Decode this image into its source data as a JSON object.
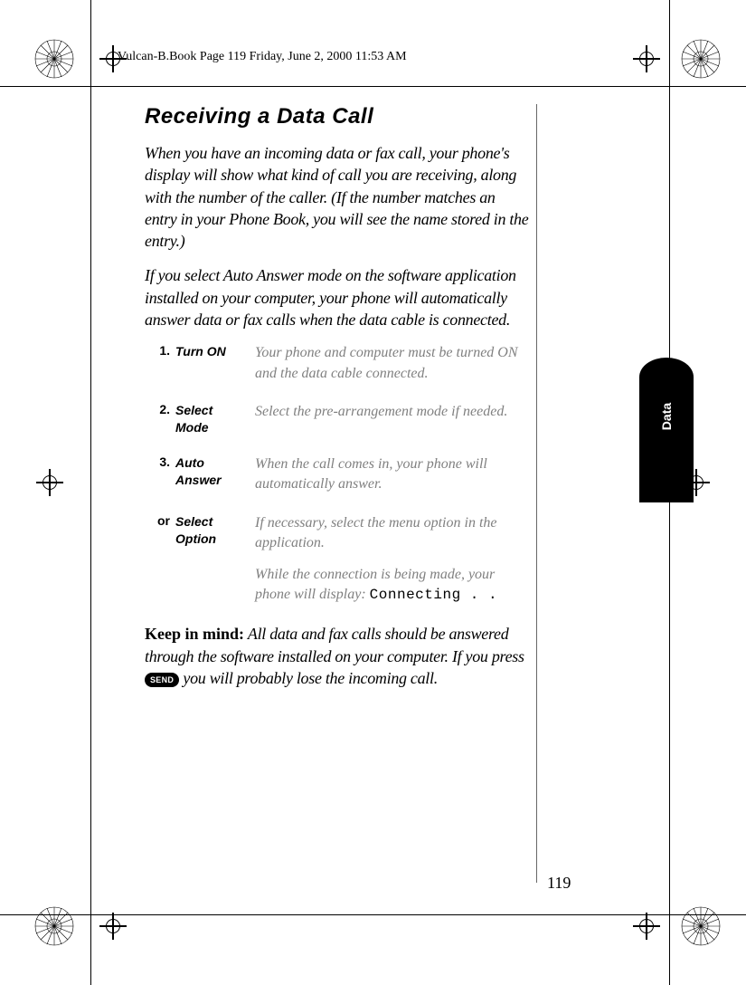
{
  "header": "Vulcan-B.Book  Page 119  Friday, June 2, 2000  11:53 AM",
  "title": "Receiving a Data Call",
  "para1": "When you have an incoming data or fax call, your phone's display will show what kind of call you are receiving, along with the number of the caller. (If the number matches an entry in your Phone Book, you will see the name stored in the entry.)",
  "para2": "If you select Auto Answer mode on the software application installed on your computer, your phone will automatically answer data or fax calls when the data cable is connected.",
  "steps": [
    {
      "num": "1.",
      "action": "Turn ON",
      "desc": "Your phone and computer must be turned ON and the data cable connected."
    },
    {
      "num": "2.",
      "action": "Select Mode",
      "desc": "Select the pre-arrangement mode if needed."
    },
    {
      "num": "3.",
      "action": "Auto Answer",
      "desc": "When the call comes in, your phone will automatically answer."
    },
    {
      "num": "or",
      "action": "Select Option",
      "desc": "If necessary, select the menu option in the application.",
      "desc2_pre": "While the connection is being made, your phone will display: ",
      "desc2_mono": "Connecting . ."
    }
  ],
  "keep_lead": "Keep in mind:",
  "keep_body_a": " All data and fax calls should be answered through the software installed on your computer. If you press ",
  "send_label": "SEND",
  "keep_body_b": " you will probably lose the incoming call.",
  "side_tab": "Data",
  "page_number": "119"
}
